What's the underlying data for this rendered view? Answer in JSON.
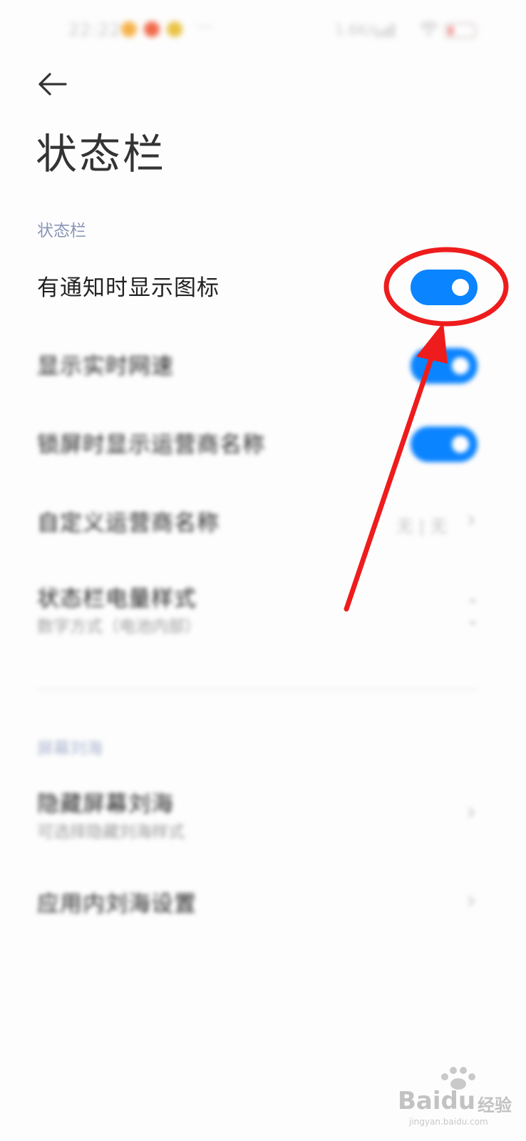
{
  "status_bar": {
    "time": "22:22",
    "more_dots": "···",
    "network_speed": "1.6K/s",
    "icons": [
      "notification-icon-1",
      "notification-icon-2",
      "notification-icon-3",
      "signal-icon",
      "wifi-icon",
      "battery-icon"
    ],
    "notification_colors": [
      "#f5b24a",
      "#f06a4a",
      "#e9c347"
    ]
  },
  "header": {
    "back_icon": "arrow-left-icon",
    "title": "状态栏"
  },
  "sections": [
    {
      "header": "状态栏",
      "rows": [
        {
          "label": "有通知时显示图标",
          "control": "toggle",
          "checked": true
        },
        {
          "label": "显示实时网速",
          "control": "toggle",
          "checked": true
        },
        {
          "label": "锁屏时显示运营商名称",
          "control": "toggle",
          "checked": true
        },
        {
          "label": "自定义运营商名称",
          "control": "chevron",
          "value": "无 | 无"
        },
        {
          "label": "状态栏电量样式",
          "subtitle": "数字方式（电池内部）",
          "control": "updown"
        }
      ]
    },
    {
      "header": "屏幕刘海",
      "rows": [
        {
          "label": "隐藏屏幕刘海",
          "subtitle": "可选择隐藏刘海样式",
          "control": "chevron"
        },
        {
          "label": "应用内刘海设置",
          "control": "chevron"
        }
      ]
    }
  ],
  "glyphs": {
    "chevron": "›",
    "up": "⌃",
    "down": "⌄"
  },
  "colors": {
    "toggle_on": "#0b84ff",
    "annotation": "#ee1c1c",
    "section_header": "#8a96b8"
  },
  "watermark": {
    "brand": "Bai",
    "brand_tail": "du",
    "cn": "经验",
    "url": "jingyan.baidu.com"
  }
}
